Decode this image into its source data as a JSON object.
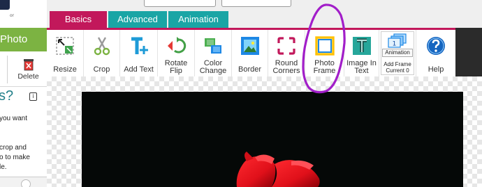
{
  "sidebar": {
    "logo_sub": "or",
    "photo_button": "Photo",
    "delete_label": "Delete",
    "help_heading": "s?",
    "info_icon": "i",
    "help_lines": [
      "you want",
      "crop and",
      "o to make",
      "le."
    ]
  },
  "tabs": [
    {
      "label": "Basics",
      "active": true
    },
    {
      "label": "Advanced",
      "active": false
    },
    {
      "label": "Animation",
      "active": false
    }
  ],
  "toolbar": {
    "resize": "Resize",
    "crop": "Crop",
    "add_text": "Add Text",
    "rotate_flip": [
      "Rotate",
      "Flip"
    ],
    "color_change": [
      "Color",
      "Change"
    ],
    "border": "Border",
    "round_corners": [
      "Round",
      "Corners"
    ],
    "photo_frame": [
      "Photo",
      "Frame"
    ],
    "image_in_text": [
      "Image In",
      "Text"
    ],
    "animation": {
      "button": "Animation",
      "add_frame": "Add Frame",
      "current": "Current 0",
      "frame_number": "1"
    },
    "help": "Help"
  },
  "colors": {
    "accent_pink": "#c2185b",
    "tab_teal": "#1aa5a5",
    "photo_green": "#7cb342",
    "annotation_purple": "#a21ec9",
    "help_blue": "#1565c0"
  }
}
